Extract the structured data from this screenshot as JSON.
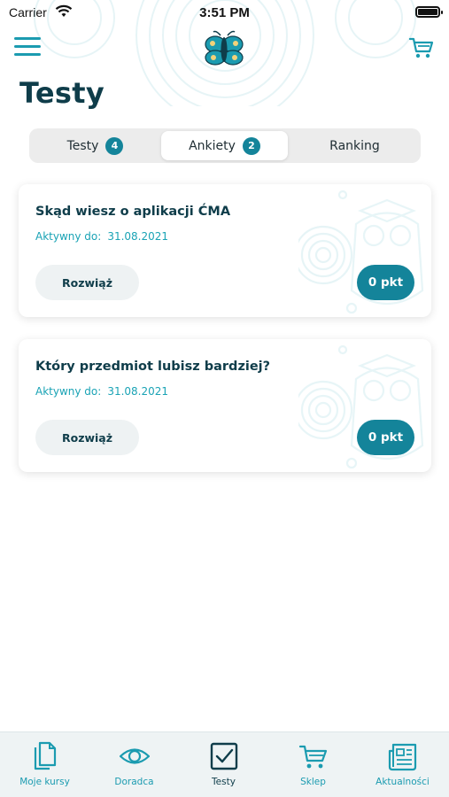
{
  "status_bar": {
    "carrier": "Carrier",
    "time": "3:51 PM"
  },
  "page_title": "Testy",
  "tabs": [
    {
      "label": "Testy",
      "badge": "4",
      "active": false
    },
    {
      "label": "Ankiety",
      "badge": "2",
      "active": true
    },
    {
      "label": "Ranking",
      "badge": "",
      "active": false
    }
  ],
  "cards": [
    {
      "title": "Skąd wiesz o aplikacji ĆMA",
      "date_label": "Aktywny do:",
      "date": "31.08.2021",
      "solve_label": "Rozwiąż",
      "points": "0 pkt"
    },
    {
      "title": "Który przedmiot lubisz bardziej?",
      "date_label": "Aktywny do:",
      "date": "31.08.2021",
      "solve_label": "Rozwiąż",
      "points": "0 pkt"
    }
  ],
  "bottom_nav": [
    {
      "label": "Moje kursy",
      "icon": "documents-icon",
      "active": false
    },
    {
      "label": "Doradca",
      "icon": "eye-icon",
      "active": false
    },
    {
      "label": "Testy",
      "icon": "checkbox-icon",
      "active": true
    },
    {
      "label": "Sklep",
      "icon": "cart-icon",
      "active": false
    },
    {
      "label": "Aktualności",
      "icon": "newspaper-icon",
      "active": false
    }
  ],
  "colors": {
    "accent": "#1b9bb0",
    "accent_dark": "#14849a",
    "text_dark": "#0f3d4a"
  }
}
